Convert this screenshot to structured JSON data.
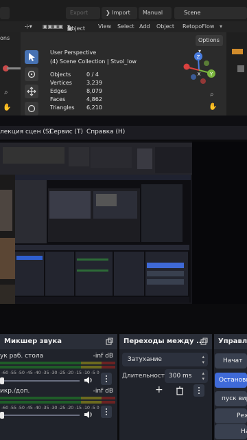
{
  "blender": {
    "top": {
      "export": "Export",
      "import": "Import",
      "manual": "Manual",
      "scene": "Scene"
    },
    "header": {
      "mode": "Object Mode",
      "view": "View",
      "select": "Select",
      "add": "Add",
      "object": "Object",
      "addon": "RetopoFlow",
      "options": "Options"
    },
    "outliner": {
      "op_label": "ons"
    },
    "stats": {
      "perspective": "User Perspective",
      "collection": "(4) Scene Collection | Stvol_low",
      "rows": [
        {
          "label": "Objects",
          "value": "0 / 4"
        },
        {
          "label": "Vertices",
          "value": "3,239"
        },
        {
          "label": "Edges",
          "value": "8,079"
        },
        {
          "label": "Faces",
          "value": "4,862"
        },
        {
          "label": "Triangles",
          "value": "6,210"
        }
      ]
    },
    "gizmo": {
      "z": "Z",
      "x": "X",
      "y": "Y"
    }
  },
  "obs": {
    "menu": {
      "scene_collection": "лекция сцен (S)",
      "tools": "Сервис (T)",
      "help": "Справка (H)"
    },
    "mixer": {
      "title": "Микшер звука",
      "scale": "-60 -55 -50 -45 -40 -35 -30 -25 -20 -15 -10  -5   0",
      "channels": [
        {
          "name": "ук раб. стола",
          "db": "-inf dB",
          "volume": 0.0
        },
        {
          "name": "икр./доп.",
          "db": "-inf dB",
          "volume": 0.0
        }
      ]
    },
    "transitions": {
      "title": "Переходы между ...",
      "type": "Затухание",
      "duration_label": "Длительность",
      "duration": "300 ms"
    },
    "controls": {
      "title": "Управле",
      "buttons": [
        "Начат",
        "Останови",
        "пуск вирт",
        "Реж",
        "На"
      ]
    }
  },
  "colors": {
    "accent": "#3f6ad8",
    "blender_active": "#4772b3",
    "meter_green": "#1f5d28"
  }
}
